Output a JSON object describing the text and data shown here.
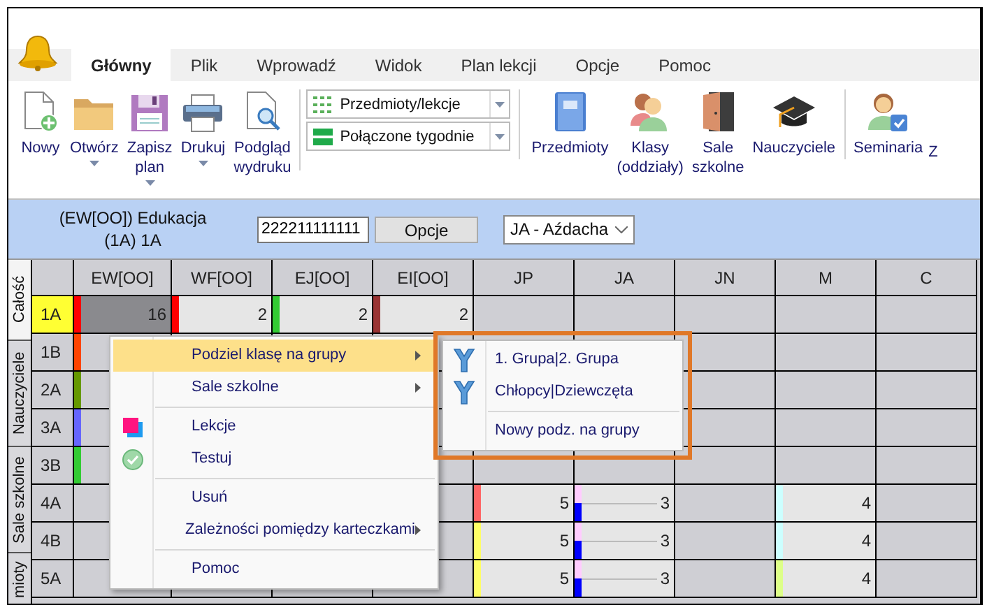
{
  "tabs": [
    {
      "label": "Główny",
      "selected": true
    },
    {
      "label": "Plik",
      "selected": false
    },
    {
      "label": "Wprowadź",
      "selected": false
    },
    {
      "label": "Widok",
      "selected": false
    },
    {
      "label": "Plan lekcji",
      "selected": false
    },
    {
      "label": "Opcje",
      "selected": false
    },
    {
      "label": "Pomoc",
      "selected": false
    }
  ],
  "ribbon": {
    "file_buttons": [
      {
        "label": "Nowy",
        "has_menu": false
      },
      {
        "label": "Otwórz",
        "has_menu": true
      },
      {
        "label": "Zapisz plan",
        "has_menu": true
      },
      {
        "label": "Drukuj",
        "has_menu": true
      },
      {
        "label": "Podgląd wydruku",
        "has_menu": false
      }
    ],
    "view_combos": [
      "Przedmioty/lekcje",
      "Połączone tygodnie"
    ],
    "data_buttons": [
      "Przedmioty",
      "Klasy (oddziały)",
      "Sale szkolne",
      "Nauczyciele"
    ],
    "extra_buttons": [
      "Seminaria",
      "Z"
    ]
  },
  "filter_bar": {
    "label_lines": [
      "(EW[OO]) Edukacja",
      "(1A) 1A"
    ],
    "input_value": "222211111111",
    "options_button": "Opcje",
    "teacher_select": "JA - Aźdacha"
  },
  "side_tabs": [
    {
      "label": "Całość",
      "selected": true
    },
    {
      "label": "Nauczyciele",
      "selected": false
    },
    {
      "label": "Sale szkolne",
      "selected": false
    },
    {
      "label": "mioty",
      "selected": false
    }
  ],
  "grid": {
    "columns": [
      "EW[OO]",
      "WF[OO]",
      "EJ[OO]",
      "EI[OO]",
      "JP",
      "JA",
      "JN",
      "M",
      "C"
    ],
    "rows": [
      {
        "label": "1A",
        "selected": true,
        "cells": [
          {
            "kind": "dark",
            "value": "16",
            "color": "#ff0000"
          },
          {
            "kind": "plain",
            "value": "2",
            "color": "#ff0000"
          },
          {
            "kind": "plain",
            "value": "2",
            "color": "#33cc33"
          },
          {
            "kind": "plain",
            "value": "2",
            "color": "#993333"
          },
          null,
          null,
          null,
          null,
          null
        ]
      },
      {
        "label": "1B",
        "selected": false,
        "cells": [
          {
            "kind": "stripe",
            "color": "#ff4400"
          },
          null,
          null,
          null,
          null,
          null,
          null,
          null,
          null
        ]
      },
      {
        "label": "2A",
        "selected": false,
        "cells": [
          {
            "kind": "stripe",
            "color": "#669900"
          },
          null,
          null,
          null,
          null,
          null,
          null,
          null,
          null
        ]
      },
      {
        "label": "3A",
        "selected": false,
        "cells": [
          {
            "kind": "stripe",
            "color": "#6666ff"
          },
          null,
          null,
          null,
          null,
          null,
          null,
          null,
          null
        ]
      },
      {
        "label": "3B",
        "selected": false,
        "cells": [
          {
            "kind": "stripe",
            "color": "#33cc33"
          },
          null,
          null,
          null,
          null,
          null,
          null,
          null,
          null
        ]
      },
      {
        "label": "4A",
        "selected": false,
        "cells": [
          null,
          null,
          null,
          null,
          {
            "kind": "plain",
            "value": "5",
            "color": "#ff6666"
          },
          {
            "kind": "split",
            "value": "3",
            "color": "#ffccff"
          },
          null,
          {
            "kind": "plain",
            "value": "4",
            "color": "#ccffff"
          },
          null
        ]
      },
      {
        "label": "4B",
        "selected": false,
        "cells": [
          null,
          null,
          null,
          null,
          {
            "kind": "plain",
            "value": "5",
            "color": "#ffff66"
          },
          {
            "kind": "split",
            "value": "3",
            "color": "#ffccff"
          },
          null,
          {
            "kind": "plain",
            "value": "4",
            "color": "#ccffff"
          },
          null
        ]
      },
      {
        "label": "5A",
        "selected": false,
        "cells": [
          null,
          null,
          null,
          null,
          {
            "kind": "plain",
            "value": "5",
            "color": "#ffff66"
          },
          {
            "kind": "split",
            "value": "3",
            "color": "#ffccff"
          },
          null,
          {
            "kind": "plain",
            "value": "4",
            "color": "#ddff88"
          },
          null
        ]
      }
    ]
  },
  "context_menu": {
    "items": [
      {
        "kind": "item",
        "label": "Podziel klasę na grupy",
        "submenu": true,
        "highlighted": true
      },
      {
        "kind": "item",
        "label": "Sale szkolne",
        "submenu": true,
        "highlighted": false
      },
      {
        "kind": "separator"
      },
      {
        "kind": "item",
        "label": "Lekcje",
        "submenu": false,
        "highlighted": false
      },
      {
        "kind": "item",
        "label": "Testuj",
        "submenu": false,
        "highlighted": false
      },
      {
        "kind": "separator"
      },
      {
        "kind": "item",
        "label": "Usuń",
        "submenu": false,
        "highlighted": false
      },
      {
        "kind": "item",
        "label": "Zależności pomiędzy karteczkami",
        "submenu": true,
        "highlighted": false
      },
      {
        "kind": "separator"
      },
      {
        "kind": "item",
        "label": "Pomoc",
        "submenu": false,
        "highlighted": false
      }
    ]
  },
  "submenu": {
    "items": [
      {
        "kind": "item",
        "label": "1. Grupa|2. Grupa"
      },
      {
        "kind": "item",
        "label": "Chłopcy|Dziewczęta"
      },
      {
        "kind": "separator"
      },
      {
        "kind": "item",
        "label": "Nowy podz. na grupy"
      }
    ]
  }
}
